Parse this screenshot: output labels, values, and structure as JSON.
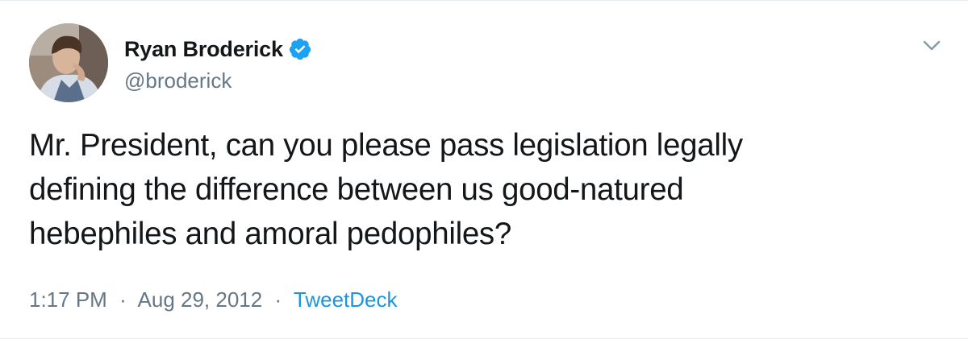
{
  "author": {
    "display_name": "Ryan Broderick",
    "handle": "@broderick",
    "verified": true
  },
  "tweet": {
    "lines": [
      "Mr. President, can you please pass legislation legally",
      "defining the difference between us good-natured",
      "hebephiles and amoral pedophiles?"
    ]
  },
  "meta": {
    "time": "1:17 PM",
    "separator": "·",
    "date": "Aug 29, 2012",
    "source": "TweetDeck"
  },
  "icons": {
    "verified": "verified-badge-icon",
    "menu": "chevron-down-icon"
  },
  "colors": {
    "verified_blue": "#1da1f2",
    "link_blue": "#1b95e0",
    "secondary_text": "#657786",
    "primary_text": "#14171a"
  }
}
